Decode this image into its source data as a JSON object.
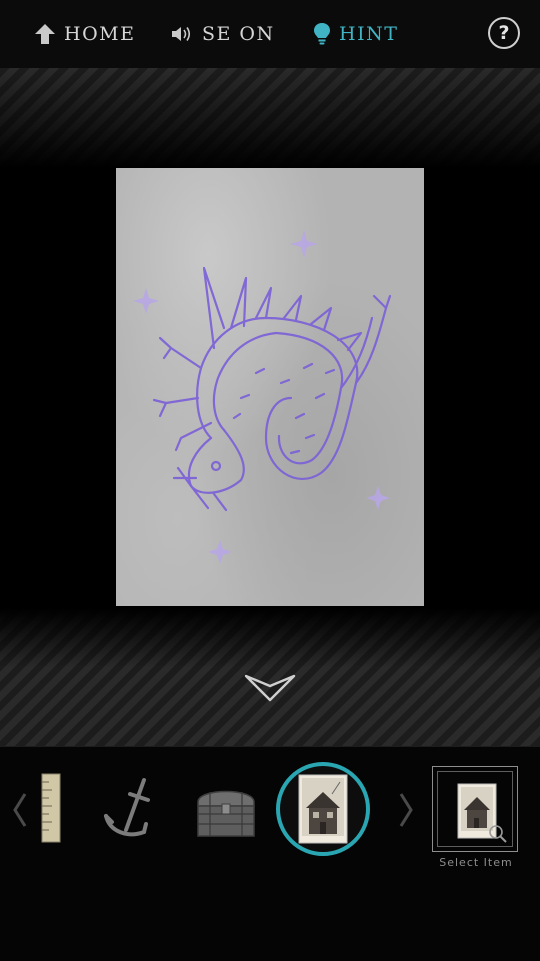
{
  "topbar": {
    "home_label": "HOME",
    "se_label": "SE ON",
    "hint_label": "HINT",
    "help_label": "?"
  },
  "colors": {
    "hint_accent": "#40b4c4",
    "selected_ring": "#2aa6b3",
    "dragon_ink": "#8a6fe0"
  },
  "inventory": {
    "items": [
      "ruler",
      "anchor",
      "treasure-chest",
      "house-photo"
    ],
    "selected_item": "house-photo",
    "select_item_label": "Select Item"
  }
}
